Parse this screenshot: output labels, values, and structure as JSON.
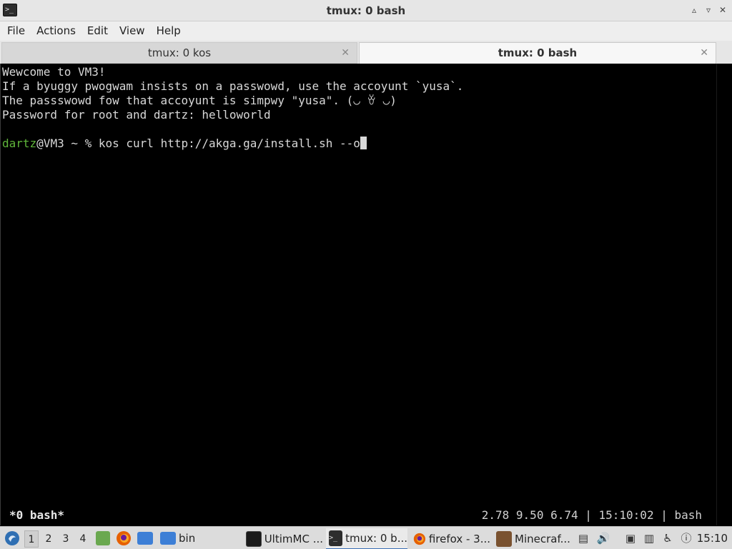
{
  "window": {
    "title": "tmux: 0 bash",
    "controls": [
      "▵",
      "▿",
      "✕"
    ]
  },
  "menubar": {
    "items": [
      "File",
      "Actions",
      "Edit",
      "View",
      "Help"
    ]
  },
  "tabs": [
    {
      "label": "tmux: 0 kos",
      "close": "✕"
    },
    {
      "label": "tmux: 0 bash",
      "close": "✕"
    }
  ],
  "terminal": {
    "lines": [
      "Wewcome to VM3!",
      "If a byuggy pwogwam insists on a passwowd, use the accoyunt `yusa`.",
      "The passswowd fow that accoyunt is simpwy \"yusa\". (◡ ꈊ ◡)",
      "Password for root and dartz: helloworld"
    ],
    "prompt_user": "dartz",
    "prompt_rest": "@VM3 ~ % kos curl http://akga.ga/install.sh --o",
    "status_left": "*0 bash*",
    "status_right": "2.78 9.50 6.74 | 15:10:02 | bash"
  },
  "taskbar": {
    "workspaces": [
      "1",
      "2",
      "3",
      "4"
    ],
    "folder_label": "bin",
    "tasks": [
      {
        "label": "UltimMC ..."
      },
      {
        "label": "tmux: 0 b..."
      },
      {
        "label": "firefox - 3..."
      },
      {
        "label": "Minecraf..."
      }
    ],
    "clock": "15:10",
    "colors": {
      "accent": "#3b6fb6",
      "prompt_green": "#5fb53a",
      "firefox": "#e66000",
      "folder": "#3d7fd6"
    }
  }
}
